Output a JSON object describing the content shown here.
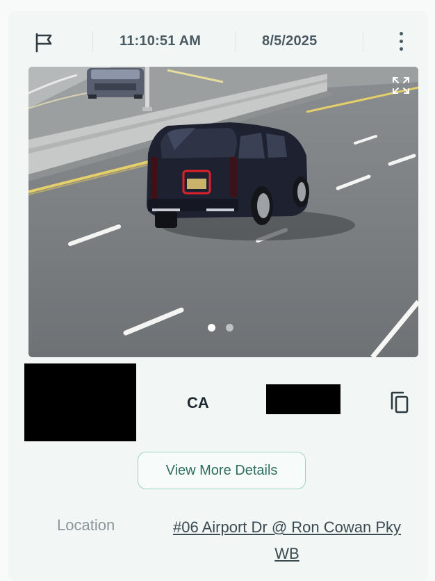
{
  "header": {
    "flag_icon": "flag-icon",
    "time": "11:10:51 AM",
    "date": "8/5/2025",
    "menu_icon": "more-vertical-icon"
  },
  "image": {
    "expand_icon": "expand-icon",
    "slide_count": 2,
    "active_slide": 1
  },
  "plate": {
    "state": "CA",
    "copy_icon": "copy-icon"
  },
  "actions": {
    "details_label": "View More Details"
  },
  "location": {
    "label": "Location",
    "value": "#06 Airport Dr @ Ron Cowan Pky WB"
  },
  "colors": {
    "card_bg": "#f2f6f5",
    "accent_teal": "#2f6d5d",
    "button_border": "#9fd4c0",
    "plate_highlight": "#e0202a"
  }
}
